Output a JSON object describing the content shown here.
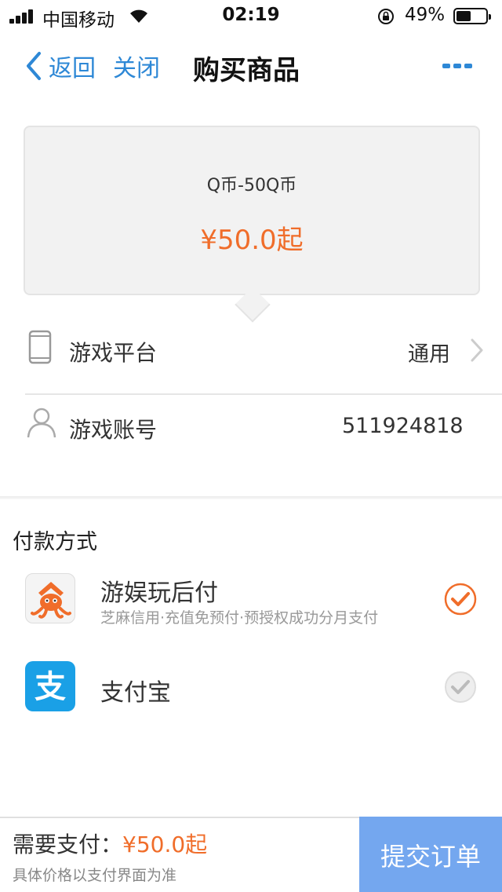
{
  "status_bar": {
    "carrier": "中国移动",
    "time": "02:19",
    "battery_percent": "49%",
    "battery_level": 0.49,
    "icons": [
      "signal-icon",
      "wifi-icon",
      "rotation-lock-icon",
      "battery-icon"
    ]
  },
  "nav": {
    "back_label": "返回",
    "close_label": "关闭",
    "title": "购买商品",
    "more_icon": "more-dots-icon"
  },
  "product": {
    "name": "Q币-50Q币",
    "price": "¥50.0起"
  },
  "info": {
    "platform_label": "游戏平台",
    "platform_value": "通用",
    "account_label": "游戏账号",
    "account_value": "511924818"
  },
  "payment": {
    "section_title": "付款方式",
    "options": [
      {
        "name": "游娱玩后付",
        "description": "芝麻信用·充值免预付·预授权成功分月支付",
        "selected": true,
        "logo_icon": "octopus-logo-icon"
      },
      {
        "name": "支付宝",
        "description": "",
        "selected": false,
        "logo_icon": "alipay-logo-icon"
      }
    ]
  },
  "bottom": {
    "need_pay_label": "需要支付：",
    "need_pay_amount": "¥50.0起",
    "note": "具体价格以支付界面为准",
    "submit_label": "提交订单"
  },
  "colors": {
    "accent_blue": "#2e88d6",
    "price_orange": "#f06d2a",
    "submit_bg": "#74a7ef",
    "alipay_blue": "#1aa0e6"
  }
}
